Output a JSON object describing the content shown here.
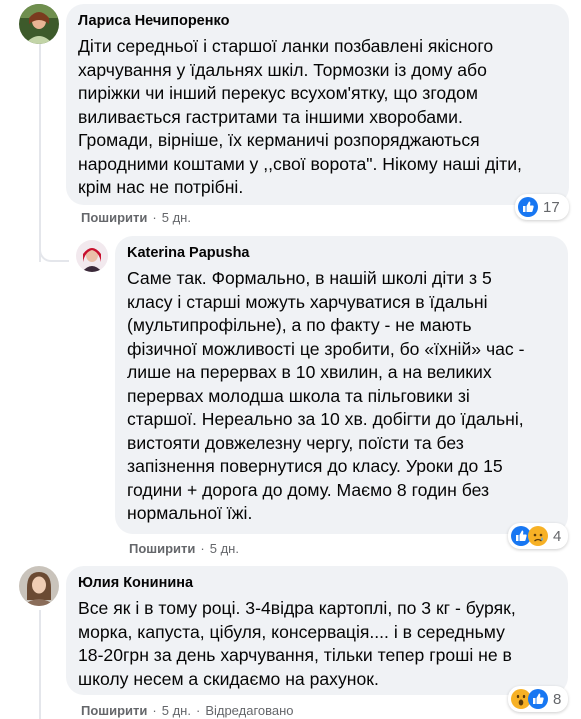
{
  "comments": [
    {
      "author": "Лариса Нечипоренко",
      "text": "Діти середньої і старшої ланки позбавлені якісного\nхарчування у їдальнях шкіл. Тормозки із дому або\nпиріжки чи інший перекус всухом'ятку, що згодом\nвиливається гастритами та іншими хворобами.\nГромади, вірніше, їх керманичі розпоряджаються\nнародними коштами у ,,свої ворота\". Нікому наші діти,\nкрім нас не потрібні.",
      "share": "Поширити",
      "time": "5 дн.",
      "reaction_count": "17",
      "reactions": [
        "like-icon"
      ]
    },
    {
      "author": "Katerina Papusha",
      "text": "Саме так. Формально, в нашій школі діти з 5\nкласу і старші можуть харчуватися в їдальні\n(мультипрофільне), а по факту - не мають\nфізичної можливості це зробити, бо «їхній» час -\nлише на перервах в 10 хвилин, а на великих\nперервах молодша школа та пільговики зі\nстаршої. Нереально за 10 хв. добігти до їдальні,\nвистояти довжелезну чергу, поїсти та без\nзапізнення повернутися до класу. Уроки до 15\nгодини + дорога до дому. Маємо 8 годин без\nнормальної їжі.",
      "share": "Поширити",
      "time": "5 дн.",
      "reaction_count": "4",
      "reactions": [
        "like-icon",
        "sad-icon"
      ]
    },
    {
      "author": "Юлия Конинина",
      "text": "Все як і в тому році. 3-4відра картоплі, по 3 кг - буряк,\nморка, капуста, цібуля, консервація.... і в середньму\n18-20грн за день харчування, тільки тепер гроші не в\nшколу несем а скидаємо на рахунок.",
      "share": "Поширити",
      "time": "5 дн.",
      "edited": "Відредаговано",
      "reaction_count": "8",
      "reactions": [
        "wow-icon",
        "like-icon"
      ]
    }
  ],
  "colors": {
    "bubble": "#f0f2f5",
    "meta_text": "#65676b",
    "like_blue": "#1877f2",
    "emoji_yellow": "#f7b125"
  }
}
